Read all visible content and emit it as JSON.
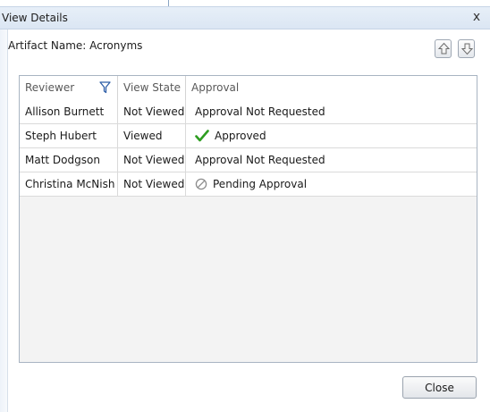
{
  "dialog": {
    "title": "View Details",
    "close_glyph": "x"
  },
  "artifact": {
    "label": "Artifact Name: ",
    "value": "Acronyms"
  },
  "toolbar": {
    "move_up_icon": "arrow-up-icon",
    "move_down_icon": "arrow-down-icon"
  },
  "grid": {
    "columns": [
      "Reviewer",
      "View State",
      "Approval"
    ],
    "filter_icon": "filter-icon",
    "rows": [
      {
        "reviewer": "Allison Burnett",
        "view_state": "Not Viewed",
        "approval": "Approval Not Requested",
        "status_icon": ""
      },
      {
        "reviewer": "Steph Hubert",
        "view_state": "Viewed",
        "approval": "Approved",
        "status_icon": "check-icon"
      },
      {
        "reviewer": "Matt Dodgson",
        "view_state": "Not Viewed",
        "approval": "Approval Not Requested",
        "status_icon": ""
      },
      {
        "reviewer": "Christina McNish",
        "view_state": "Not Viewed",
        "approval": "Pending Approval",
        "status_icon": "pending-icon"
      }
    ]
  },
  "footer": {
    "close_label": "Close"
  },
  "colors": {
    "check": "#2e9d21",
    "pending": "#8c8c8c",
    "titlebar": "#dbe6f3"
  }
}
